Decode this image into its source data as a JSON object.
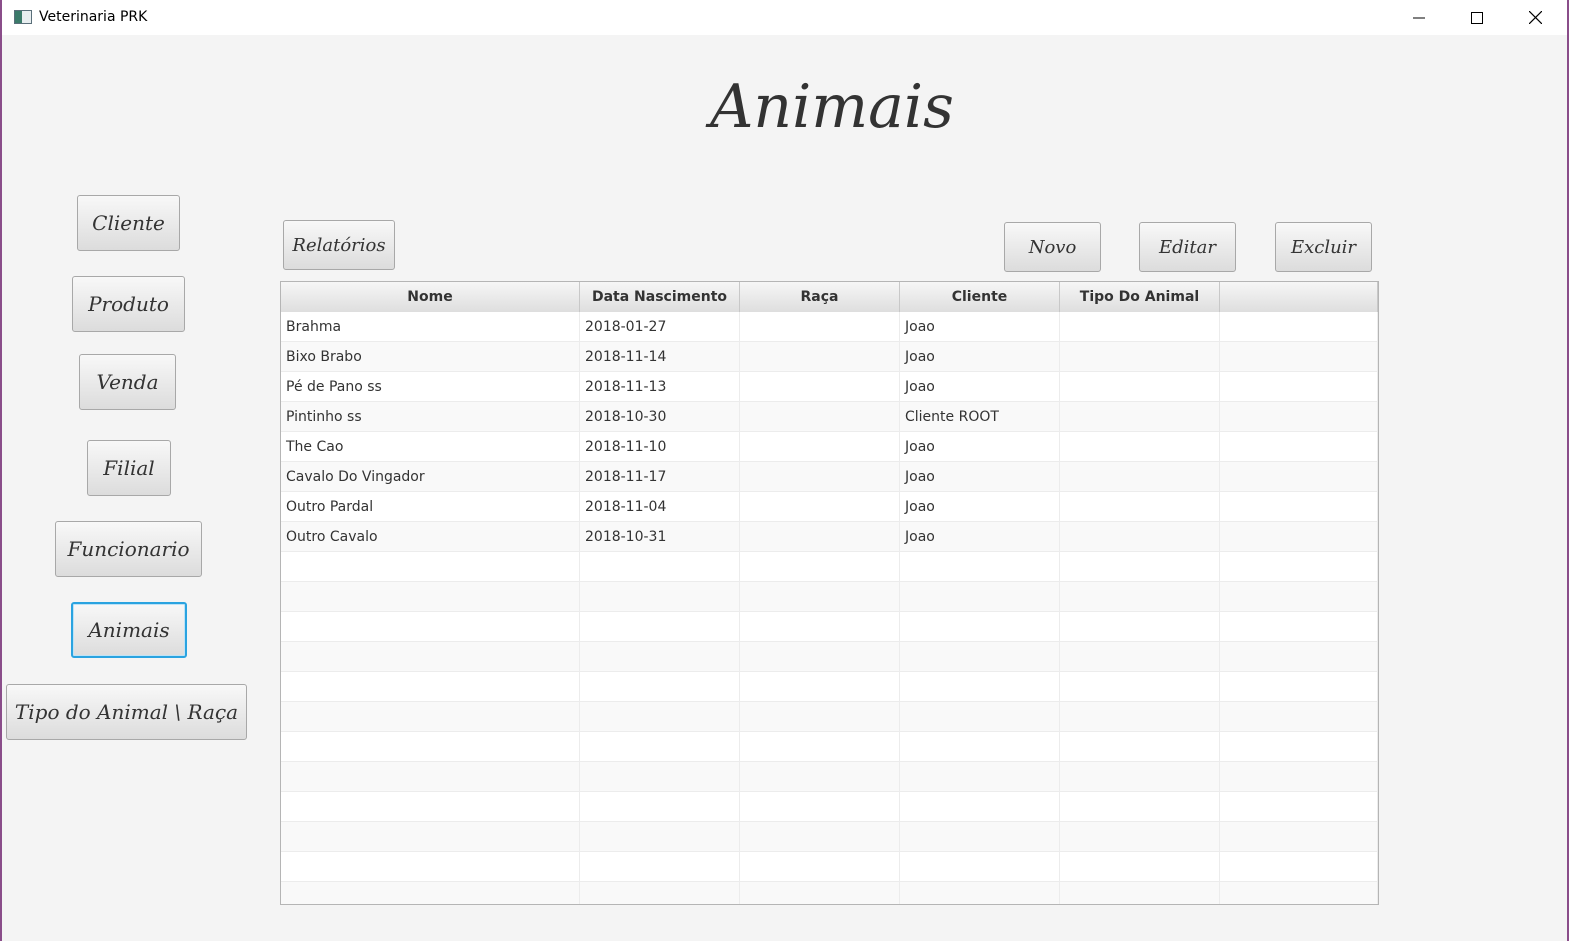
{
  "window": {
    "title": "Veterinaria PRK"
  },
  "page": {
    "title": "Animais"
  },
  "nav": {
    "items": [
      {
        "label": "Cliente"
      },
      {
        "label": "Produto"
      },
      {
        "label": "Venda"
      },
      {
        "label": "Filial"
      },
      {
        "label": "Funcionario"
      },
      {
        "label": "Animais",
        "active": true
      },
      {
        "label": "Tipo do Animal \\ Raça"
      }
    ]
  },
  "toolbar": {
    "reports_label": "Relatórios",
    "new_label": "Novo",
    "edit_label": "Editar",
    "delete_label": "Excluir"
  },
  "table": {
    "columns": [
      "Nome",
      "Data Nascimento",
      "Raça",
      "Cliente",
      "Tipo Do Animal",
      ""
    ],
    "rows": [
      [
        "Brahma",
        "2018-01-27",
        "",
        "Joao",
        "",
        ""
      ],
      [
        "Bixo Brabo",
        "2018-11-14",
        "",
        "Joao",
        "",
        ""
      ],
      [
        "Pé de Pano ss",
        "2018-11-13",
        "",
        "Joao",
        "",
        ""
      ],
      [
        "Pintinho ss",
        "2018-10-30",
        "",
        "Cliente ROOT",
        "",
        ""
      ],
      [
        "The Cao",
        "2018-11-10",
        "",
        "Joao",
        "",
        ""
      ],
      [
        "Cavalo Do Vingador",
        "2018-11-17",
        "",
        "Joao",
        "",
        ""
      ],
      [
        "Outro Pardal",
        "2018-11-04",
        "",
        "Joao",
        "",
        ""
      ],
      [
        "Outro Cavalo",
        "2018-10-31",
        "",
        "Joao",
        "",
        ""
      ]
    ]
  },
  "colors": {
    "accent": "#2aa3e0",
    "window_border": "#8a4d8a",
    "background": "#f4f4f4"
  }
}
